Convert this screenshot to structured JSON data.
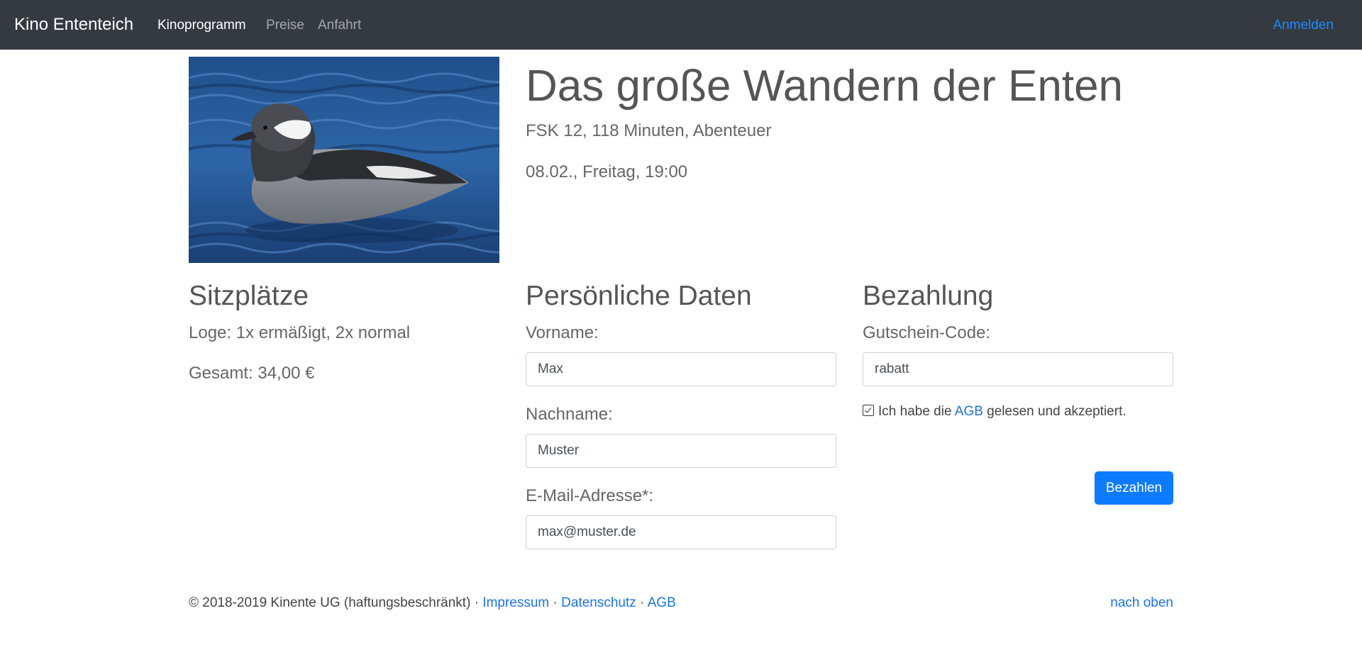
{
  "navbar": {
    "brand": "Kino Ententeich",
    "links": [
      "Kinoprogramm",
      "Preise",
      "Anfahrt"
    ],
    "login": "Anmelden"
  },
  "movie": {
    "title": "Das große Wandern der Enten",
    "info": "FSK 12, 118 Minuten, Abenteuer",
    "showtime": "08.02., Freitag, 19:00",
    "poster_icon": "duck-photo"
  },
  "seats": {
    "heading": "Sitzplätze",
    "selection": "Loge: 1x ermäßigt, 2x normal",
    "total": "Gesamt: 34,00 €"
  },
  "personal": {
    "heading": "Persönliche Daten",
    "firstname_label": "Vorname:",
    "firstname_value": "Max",
    "lastname_label": "Nachname:",
    "lastname_value": "Muster",
    "email_label": "E-Mail-Adresse*:",
    "email_value": "max@muster.de"
  },
  "payment": {
    "heading": "Bezahlung",
    "voucher_label": "Gutschein-Code:",
    "voucher_value": "rabatt",
    "terms_prefix": "Ich habe die",
    "terms_link": "AGB",
    "terms_suffix": "gelesen und akzeptiert.",
    "terms_checked": true,
    "pay_button": "Bezahlen"
  },
  "footer": {
    "copyright": "© 2018-2019 Kinente UG (haftungsbeschränkt)",
    "separator": "·",
    "links": [
      "Impressum",
      "Datenschutz",
      "AGB"
    ],
    "to_top": "nach oben"
  },
  "colors": {
    "navbar_bg": "#343a40",
    "link": "#1a73e8",
    "button": "#0d7bff"
  }
}
